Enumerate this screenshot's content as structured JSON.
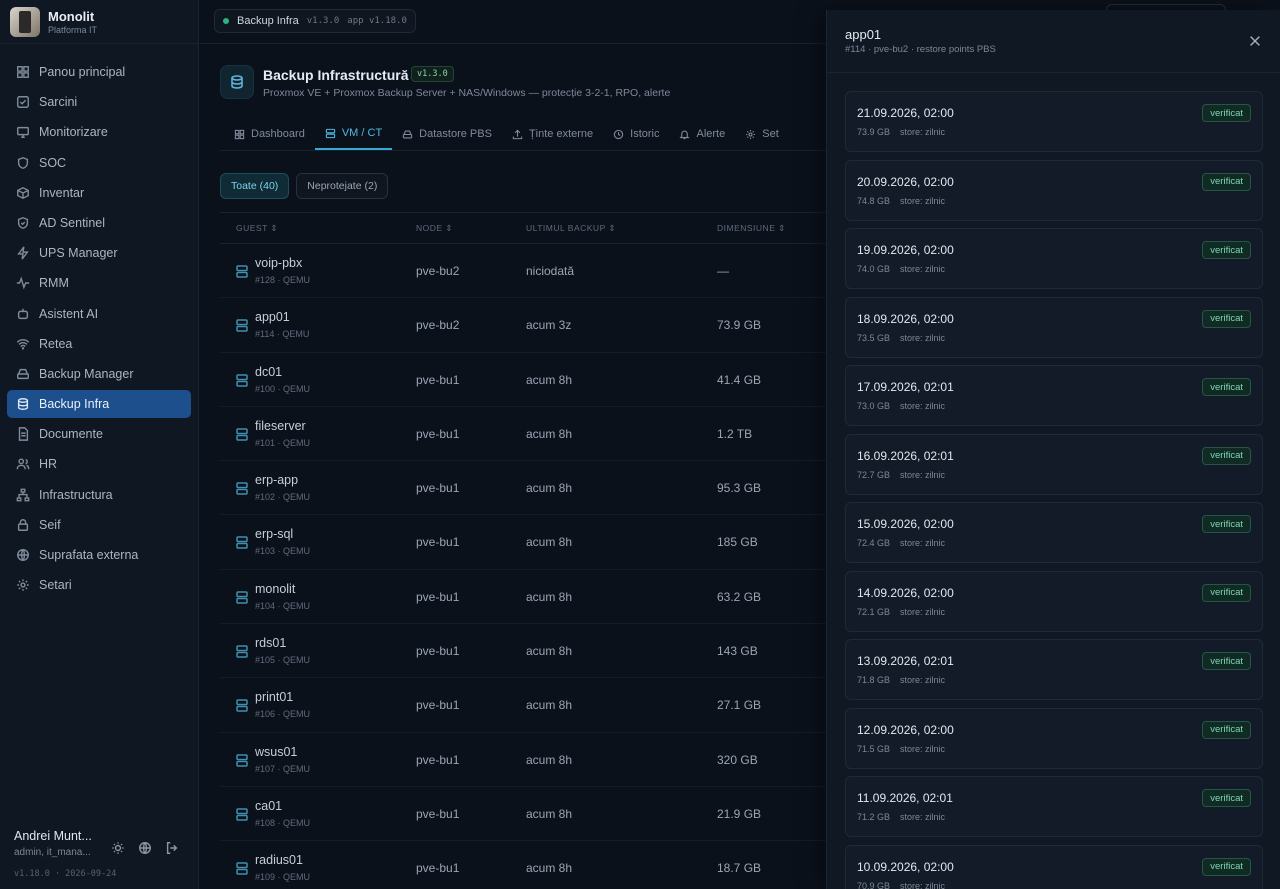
{
  "brand": {
    "name": "Monolit",
    "subtitle": "Platforma IT"
  },
  "sidebar": {
    "items": [
      {
        "label": "Panou principal",
        "icon": "grid-icon"
      },
      {
        "label": "Sarcini",
        "icon": "checkbox-icon"
      },
      {
        "label": "Monitorizare",
        "icon": "monitor-icon"
      },
      {
        "label": "SOC",
        "icon": "shield-icon"
      },
      {
        "label": "Inventar",
        "icon": "box-icon"
      },
      {
        "label": "AD Sentinel",
        "icon": "shield-check-icon"
      },
      {
        "label": "UPS Manager",
        "icon": "bolt-icon"
      },
      {
        "label": "RMM",
        "icon": "pulse-icon"
      },
      {
        "label": "Asistent AI",
        "icon": "robot-icon"
      },
      {
        "label": "Retea",
        "icon": "wifi-icon"
      },
      {
        "label": "Backup Manager",
        "icon": "drive-icon"
      },
      {
        "label": "Backup Infra",
        "icon": "database-icon",
        "active": true
      },
      {
        "label": "Documente",
        "icon": "document-icon"
      },
      {
        "label": "HR",
        "icon": "users-icon"
      },
      {
        "label": "Infrastructura",
        "icon": "network-icon"
      },
      {
        "label": "Seif",
        "icon": "lock-icon"
      },
      {
        "label": "Suprafata externa",
        "icon": "globe-icon"
      },
      {
        "label": "Setari",
        "icon": "gear-icon"
      }
    ]
  },
  "user": {
    "name": "Andrei Munt...",
    "role": "admin, it_mana...",
    "version": "v1.18.0 · 2026-09-24"
  },
  "topbar": {
    "crumb_title": "Backup Infra",
    "crumb_version": "v1.3.0",
    "crumb_app": "app v1.18.0"
  },
  "header": {
    "title": "Backup Infrastructură",
    "version": "v1.3.0",
    "subtitle": "Proxmox VE + Proxmox Backup Server + NAS/Windows — protecție 3-2-1, RPO, alerte"
  },
  "tabs": [
    {
      "label": "Dashboard",
      "icon": "grid-icon"
    },
    {
      "label": "VM / CT",
      "icon": "server-icon",
      "active": true
    },
    {
      "label": "Datastore PBS",
      "icon": "drive-icon"
    },
    {
      "label": "Ținte externe",
      "icon": "upload-icon"
    },
    {
      "label": "Istoric",
      "icon": "history-icon"
    },
    {
      "label": "Alerte",
      "icon": "bell-icon"
    },
    {
      "label": "Set",
      "icon": "gear-icon"
    }
  ],
  "filters": [
    {
      "label": "Toate (40)",
      "active": true
    },
    {
      "label": "Neprotejate (2)"
    }
  ],
  "table": {
    "headers": [
      "GUEST",
      "NODE",
      "ULTIMUL BACKUP",
      "DIMENSIUNE"
    ],
    "rows": [
      {
        "name": "voip-pbx",
        "sub": "#128 · QEMU",
        "node": "pve-bu2",
        "last": "niciodată",
        "size": "—"
      },
      {
        "name": "app01",
        "sub": "#114 · QEMU",
        "node": "pve-bu2",
        "last": "acum 3z",
        "size": "73.9 GB"
      },
      {
        "name": "dc01",
        "sub": "#100 · QEMU",
        "node": "pve-bu1",
        "last": "acum 8h",
        "size": "41.4 GB"
      },
      {
        "name": "fileserver",
        "sub": "#101 · QEMU",
        "node": "pve-bu1",
        "last": "acum 8h",
        "size": "1.2 TB"
      },
      {
        "name": "erp-app",
        "sub": "#102 · QEMU",
        "node": "pve-bu1",
        "last": "acum 8h",
        "size": "95.3 GB"
      },
      {
        "name": "erp-sql",
        "sub": "#103 · QEMU",
        "node": "pve-bu1",
        "last": "acum 8h",
        "size": "185 GB"
      },
      {
        "name": "monolit",
        "sub": "#104 · QEMU",
        "node": "pve-bu1",
        "last": "acum 8h",
        "size": "63.2 GB"
      },
      {
        "name": "rds01",
        "sub": "#105 · QEMU",
        "node": "pve-bu1",
        "last": "acum 8h",
        "size": "143 GB"
      },
      {
        "name": "print01",
        "sub": "#106 · QEMU",
        "node": "pve-bu1",
        "last": "acum 8h",
        "size": "27.1 GB"
      },
      {
        "name": "wsus01",
        "sub": "#107 · QEMU",
        "node": "pve-bu1",
        "last": "acum 8h",
        "size": "320 GB"
      },
      {
        "name": "ca01",
        "sub": "#108 · QEMU",
        "node": "pve-bu1",
        "last": "acum 8h",
        "size": "21.9 GB"
      },
      {
        "name": "radius01",
        "sub": "#109 · QEMU",
        "node": "pve-bu1",
        "last": "acum 8h",
        "size": "18.7 GB"
      }
    ]
  },
  "drawer": {
    "title": "app01",
    "subtitle": "#114 · pve-bu2 · restore points PBS",
    "points": [
      {
        "date": "21.09.2026, 02:00",
        "size": "73.9 GB",
        "store": "store: zilnic",
        "status": "verificat"
      },
      {
        "date": "20.09.2026, 02:00",
        "size": "74.8 GB",
        "store": "store: zilnic",
        "status": "verificat"
      },
      {
        "date": "19.09.2026, 02:00",
        "size": "74.0 GB",
        "store": "store: zilnic",
        "status": "verificat"
      },
      {
        "date": "18.09.2026, 02:00",
        "size": "73.5 GB",
        "store": "store: zilnic",
        "status": "verificat"
      },
      {
        "date": "17.09.2026, 02:01",
        "size": "73.0 GB",
        "store": "store: zilnic",
        "status": "verificat"
      },
      {
        "date": "16.09.2026, 02:01",
        "size": "72.7 GB",
        "store": "store: zilnic",
        "status": "verificat"
      },
      {
        "date": "15.09.2026, 02:00",
        "size": "72.4 GB",
        "store": "store: zilnic",
        "status": "verificat"
      },
      {
        "date": "14.09.2026, 02:00",
        "size": "72.1 GB",
        "store": "store: zilnic",
        "status": "verificat"
      },
      {
        "date": "13.09.2026, 02:01",
        "size": "71.8 GB",
        "store": "store: zilnic",
        "status": "verificat"
      },
      {
        "date": "12.09.2026, 02:00",
        "size": "71.5 GB",
        "store": "store: zilnic",
        "status": "verificat"
      },
      {
        "date": "11.09.2026, 02:01",
        "size": "71.2 GB",
        "store": "store: zilnic",
        "status": "verificat"
      },
      {
        "date": "10.09.2026, 02:00",
        "size": "70.9 GB",
        "store": "store: zilnic",
        "status": "verificat"
      }
    ]
  },
  "colors": {
    "accent": "#1c4f8c",
    "tab_active": "#4fb9e0",
    "verified": "#7ed6b3"
  }
}
